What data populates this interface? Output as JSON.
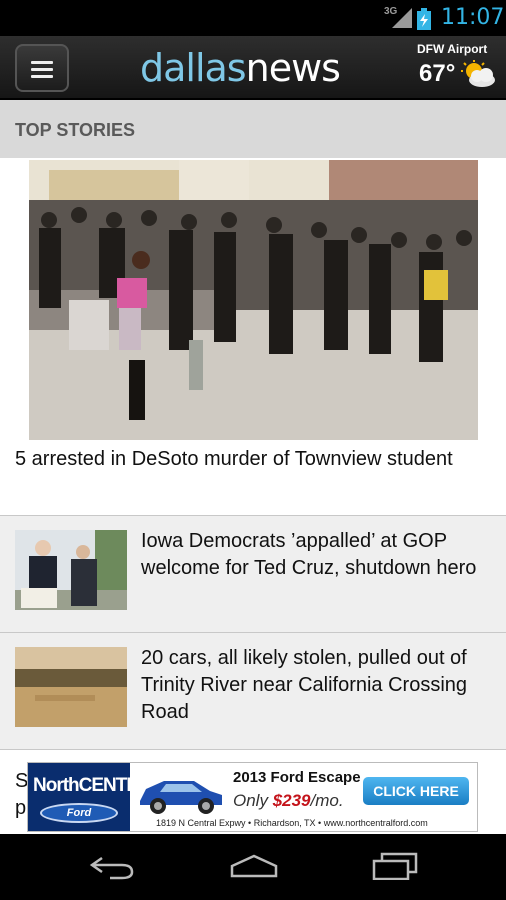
{
  "status_bar": {
    "network": "3G",
    "time": "11:07",
    "icons": [
      "signal-icon",
      "battery-icon"
    ]
  },
  "header": {
    "brand_part1": "dallas",
    "brand_part2": "news",
    "weather_location": "DFW Airport",
    "weather_temp": "67°",
    "weather_icon": "partly-cloudy-icon",
    "menu_icon": "hamburger-menu-icon"
  },
  "section": {
    "title": "TOP STORIES"
  },
  "hero": {
    "headline": "5 arrested in DeSoto murder of Townview student"
  },
  "stories": [
    {
      "headline": "Iowa Democrats ’appalled’ at GOP welcome for Ted Cruz, shutdown hero"
    },
    {
      "headline": "20 cars, all likely stolen, pulled out of Trinity River near California Crossing Road"
    }
  ],
  "partial_story": {
    "line1": "S",
    "line2": "p"
  },
  "ad": {
    "logo_line1": "NorthCENTRAL",
    "logo_line2": "Ford",
    "model": "2013 Ford Escape",
    "price_prefix": "Only ",
    "price": "$239",
    "price_suffix": "/mo.",
    "cta": "CLICK HERE",
    "address": "1819 N Central Expwy • Richardson, TX • www.northcentralford.com"
  },
  "nav_bar": {
    "icons": [
      "back-icon",
      "home-icon",
      "recent-apps-icon"
    ]
  },
  "colors": {
    "accent": "#33b5e5",
    "brand_blue": "#7fc7e6",
    "section_bg": "#d9d9d9",
    "price_red": "#c4141b"
  }
}
